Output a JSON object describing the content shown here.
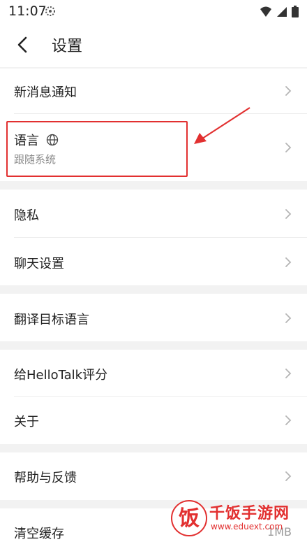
{
  "status_bar": {
    "time": "11:07",
    "icons": [
      "app-notification-icon",
      "wifi-icon",
      "signal-icon",
      "battery-icon"
    ]
  },
  "header": {
    "title": "设置",
    "back_icon": "back-arrow-icon"
  },
  "settings": {
    "notifications": {
      "label": "新消息通知"
    },
    "language": {
      "label": "语言",
      "value": "跟随系统",
      "icon": "globe-icon"
    },
    "privacy": {
      "label": "隐私"
    },
    "chat": {
      "label": "聊天设置"
    },
    "translate": {
      "label": "翻译目标语言"
    },
    "rate": {
      "label": "给HelloTalk评分"
    },
    "about": {
      "label": "关于"
    },
    "help": {
      "label": "帮助与反馈"
    },
    "clear_cache": {
      "label": "清空缓存",
      "size": "1MB"
    }
  },
  "annotation": {
    "color": "#e23030"
  },
  "watermark": {
    "logo_char": "饭",
    "title": "千饭手游网",
    "url": "www.eduext.com"
  }
}
